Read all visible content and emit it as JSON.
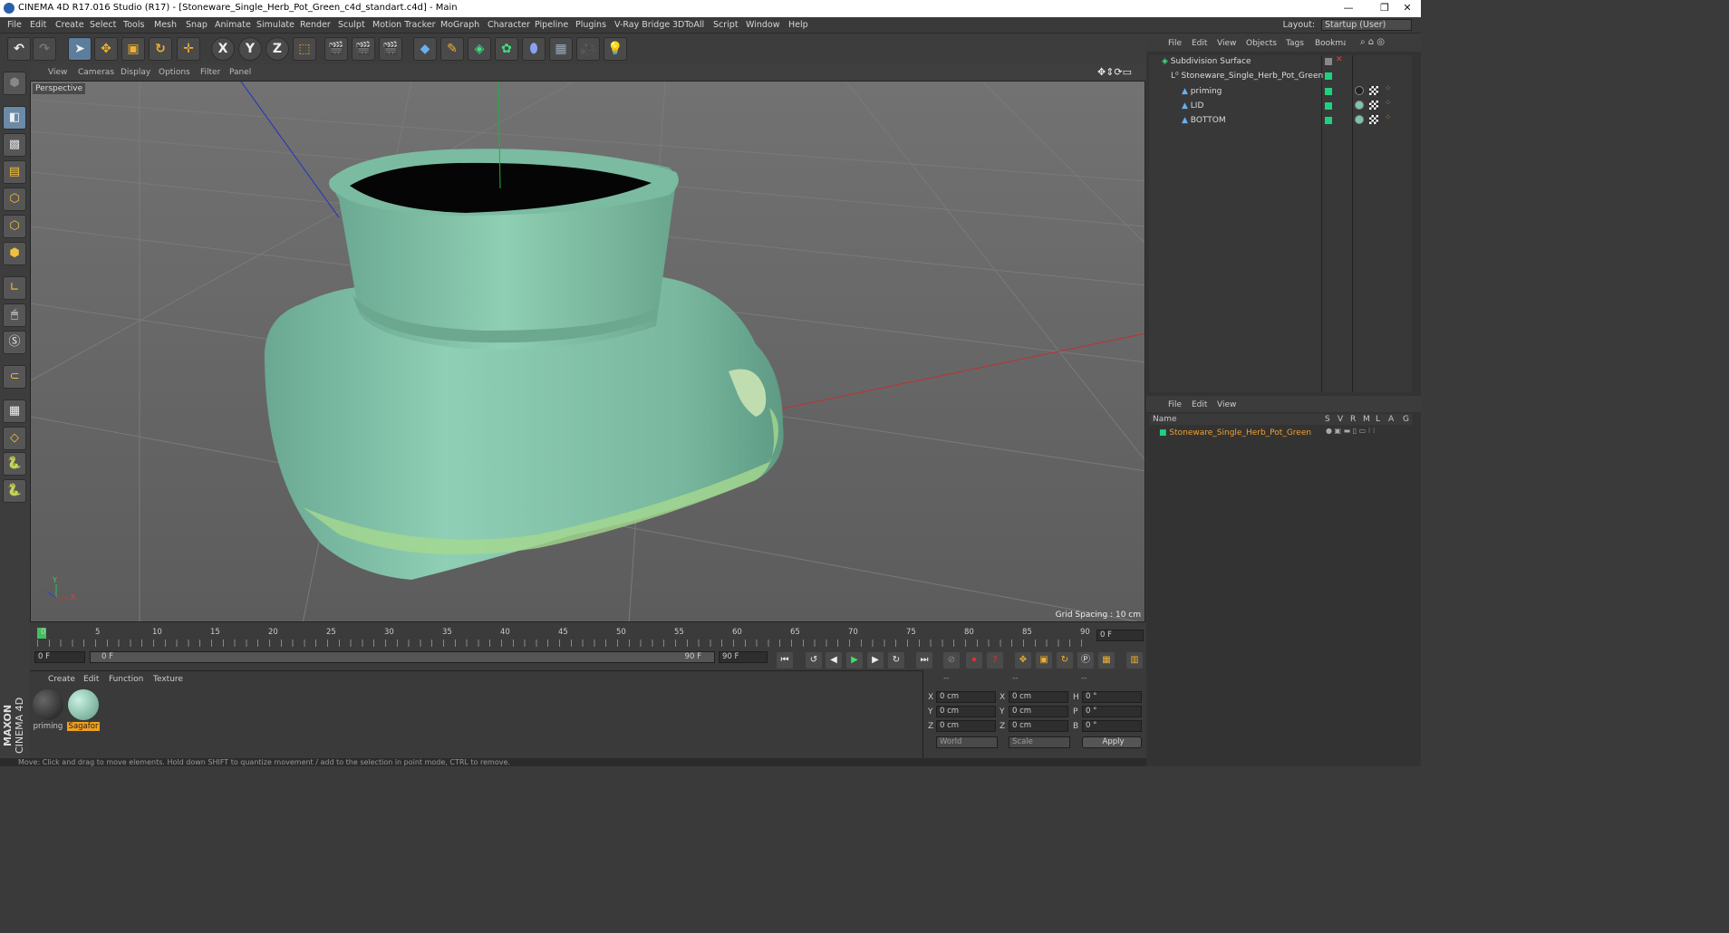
{
  "window": {
    "title": "CINEMA 4D R17.016 Studio (R17) - [Stoneware_Single_Herb_Pot_Green_c4d_standart.c4d] - Main",
    "minimize": "—",
    "restore": "❐",
    "close": "✕"
  },
  "menu": [
    "File",
    "Edit",
    "Create",
    "Select",
    "Tools",
    "Mesh",
    "Snap",
    "Animate",
    "Simulate",
    "Render",
    "Sculpt",
    "Motion Tracker",
    "MoGraph",
    "Character",
    "Pipeline",
    "Plugins",
    "V-Ray Bridge",
    "3DToAll",
    "Script",
    "Window",
    "Help"
  ],
  "layout": {
    "label": "Layout:",
    "value": "Startup (User)"
  },
  "toolbar": {
    "axis_x": "X",
    "axis_y": "Y",
    "axis_z": "Z"
  },
  "viewport": {
    "menu": [
      "View",
      "Cameras",
      "Display",
      "Options",
      "Filter",
      "Panel"
    ],
    "label": "Perspective",
    "grid_spacing": "Grid Spacing : 10 cm",
    "axis_y": "Y",
    "axis_x": "X"
  },
  "timeline": {
    "ticks": [
      "0",
      "5",
      "10",
      "15",
      "20",
      "25",
      "30",
      "35",
      "40",
      "45",
      "50",
      "55",
      "60",
      "65",
      "70",
      "75",
      "80",
      "85",
      "90"
    ],
    "current_frame": "0 F",
    "start": "0 F",
    "slider_start": "0 F",
    "slider_end": "90 F",
    "end": "90 F"
  },
  "material_panel": {
    "menu": [
      "Create",
      "Edit",
      "Function",
      "Texture"
    ],
    "materials": [
      {
        "name": "priming",
        "color": "#2a2a2a"
      },
      {
        "name": "Sagafor",
        "color": "#7ec4a6"
      }
    ]
  },
  "coords": {
    "header": [
      "--",
      "--",
      "--"
    ],
    "rows": [
      {
        "a": "X",
        "av": "0 cm",
        "b": "X",
        "bv": "0 cm",
        "c": "H",
        "cv": "0 °"
      },
      {
        "a": "Y",
        "av": "0 cm",
        "b": "Y",
        "bv": "0 cm",
        "c": "P",
        "cv": "0 °"
      },
      {
        "a": "Z",
        "av": "0 cm",
        "b": "Z",
        "bv": "0 cm",
        "c": "B",
        "cv": "0 °"
      }
    ],
    "mode": "World",
    "scale": "Scale",
    "apply": "Apply"
  },
  "object_manager": {
    "menu": [
      "File",
      "Edit",
      "View",
      "Objects",
      "Tags",
      "Bookmarks"
    ],
    "objects": [
      {
        "name": "Subdivision Surface"
      },
      {
        "name": "Stoneware_Single_Herb_Pot_Green"
      },
      {
        "name": "priming"
      },
      {
        "name": "LID"
      },
      {
        "name": "BOTTOM"
      }
    ]
  },
  "attribute_manager": {
    "menu": [
      "File",
      "Edit",
      "View"
    ],
    "columns": [
      "Name",
      "S",
      "V",
      "R",
      "M",
      "L",
      "A",
      "G"
    ],
    "row": "Stoneware_Single_Herb_Pot_Green"
  },
  "status": "Move: Click and drag to move elements. Hold down SHIFT to quantize movement / add to the selection in point mode, CTRL to remove.",
  "brand": {
    "line1": "MAXON",
    "line2": "CINEMA 4D"
  }
}
